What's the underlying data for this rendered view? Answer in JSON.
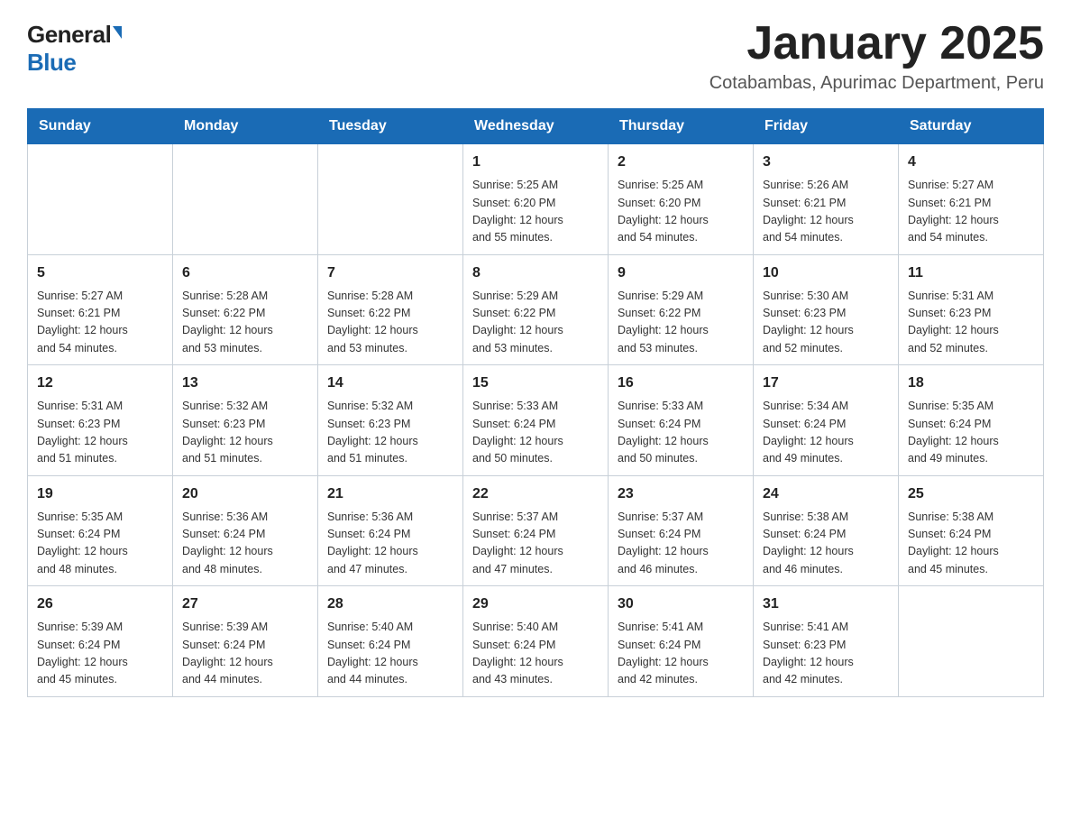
{
  "header": {
    "logo_general": "General",
    "logo_blue": "Blue",
    "title": "January 2025",
    "subtitle": "Cotabambas, Apurimac Department, Peru"
  },
  "weekdays": [
    "Sunday",
    "Monday",
    "Tuesday",
    "Wednesday",
    "Thursday",
    "Friday",
    "Saturday"
  ],
  "weeks": [
    [
      {
        "day": "",
        "info": ""
      },
      {
        "day": "",
        "info": ""
      },
      {
        "day": "",
        "info": ""
      },
      {
        "day": "1",
        "info": "Sunrise: 5:25 AM\nSunset: 6:20 PM\nDaylight: 12 hours\nand 55 minutes."
      },
      {
        "day": "2",
        "info": "Sunrise: 5:25 AM\nSunset: 6:20 PM\nDaylight: 12 hours\nand 54 minutes."
      },
      {
        "day": "3",
        "info": "Sunrise: 5:26 AM\nSunset: 6:21 PM\nDaylight: 12 hours\nand 54 minutes."
      },
      {
        "day": "4",
        "info": "Sunrise: 5:27 AM\nSunset: 6:21 PM\nDaylight: 12 hours\nand 54 minutes."
      }
    ],
    [
      {
        "day": "5",
        "info": "Sunrise: 5:27 AM\nSunset: 6:21 PM\nDaylight: 12 hours\nand 54 minutes."
      },
      {
        "day": "6",
        "info": "Sunrise: 5:28 AM\nSunset: 6:22 PM\nDaylight: 12 hours\nand 53 minutes."
      },
      {
        "day": "7",
        "info": "Sunrise: 5:28 AM\nSunset: 6:22 PM\nDaylight: 12 hours\nand 53 minutes."
      },
      {
        "day": "8",
        "info": "Sunrise: 5:29 AM\nSunset: 6:22 PM\nDaylight: 12 hours\nand 53 minutes."
      },
      {
        "day": "9",
        "info": "Sunrise: 5:29 AM\nSunset: 6:22 PM\nDaylight: 12 hours\nand 53 minutes."
      },
      {
        "day": "10",
        "info": "Sunrise: 5:30 AM\nSunset: 6:23 PM\nDaylight: 12 hours\nand 52 minutes."
      },
      {
        "day": "11",
        "info": "Sunrise: 5:31 AM\nSunset: 6:23 PM\nDaylight: 12 hours\nand 52 minutes."
      }
    ],
    [
      {
        "day": "12",
        "info": "Sunrise: 5:31 AM\nSunset: 6:23 PM\nDaylight: 12 hours\nand 51 minutes."
      },
      {
        "day": "13",
        "info": "Sunrise: 5:32 AM\nSunset: 6:23 PM\nDaylight: 12 hours\nand 51 minutes."
      },
      {
        "day": "14",
        "info": "Sunrise: 5:32 AM\nSunset: 6:23 PM\nDaylight: 12 hours\nand 51 minutes."
      },
      {
        "day": "15",
        "info": "Sunrise: 5:33 AM\nSunset: 6:24 PM\nDaylight: 12 hours\nand 50 minutes."
      },
      {
        "day": "16",
        "info": "Sunrise: 5:33 AM\nSunset: 6:24 PM\nDaylight: 12 hours\nand 50 minutes."
      },
      {
        "day": "17",
        "info": "Sunrise: 5:34 AM\nSunset: 6:24 PM\nDaylight: 12 hours\nand 49 minutes."
      },
      {
        "day": "18",
        "info": "Sunrise: 5:35 AM\nSunset: 6:24 PM\nDaylight: 12 hours\nand 49 minutes."
      }
    ],
    [
      {
        "day": "19",
        "info": "Sunrise: 5:35 AM\nSunset: 6:24 PM\nDaylight: 12 hours\nand 48 minutes."
      },
      {
        "day": "20",
        "info": "Sunrise: 5:36 AM\nSunset: 6:24 PM\nDaylight: 12 hours\nand 48 minutes."
      },
      {
        "day": "21",
        "info": "Sunrise: 5:36 AM\nSunset: 6:24 PM\nDaylight: 12 hours\nand 47 minutes."
      },
      {
        "day": "22",
        "info": "Sunrise: 5:37 AM\nSunset: 6:24 PM\nDaylight: 12 hours\nand 47 minutes."
      },
      {
        "day": "23",
        "info": "Sunrise: 5:37 AM\nSunset: 6:24 PM\nDaylight: 12 hours\nand 46 minutes."
      },
      {
        "day": "24",
        "info": "Sunrise: 5:38 AM\nSunset: 6:24 PM\nDaylight: 12 hours\nand 46 minutes."
      },
      {
        "day": "25",
        "info": "Sunrise: 5:38 AM\nSunset: 6:24 PM\nDaylight: 12 hours\nand 45 minutes."
      }
    ],
    [
      {
        "day": "26",
        "info": "Sunrise: 5:39 AM\nSunset: 6:24 PM\nDaylight: 12 hours\nand 45 minutes."
      },
      {
        "day": "27",
        "info": "Sunrise: 5:39 AM\nSunset: 6:24 PM\nDaylight: 12 hours\nand 44 minutes."
      },
      {
        "day": "28",
        "info": "Sunrise: 5:40 AM\nSunset: 6:24 PM\nDaylight: 12 hours\nand 44 minutes."
      },
      {
        "day": "29",
        "info": "Sunrise: 5:40 AM\nSunset: 6:24 PM\nDaylight: 12 hours\nand 43 minutes."
      },
      {
        "day": "30",
        "info": "Sunrise: 5:41 AM\nSunset: 6:24 PM\nDaylight: 12 hours\nand 42 minutes."
      },
      {
        "day": "31",
        "info": "Sunrise: 5:41 AM\nSunset: 6:23 PM\nDaylight: 12 hours\nand 42 minutes."
      },
      {
        "day": "",
        "info": ""
      }
    ]
  ]
}
